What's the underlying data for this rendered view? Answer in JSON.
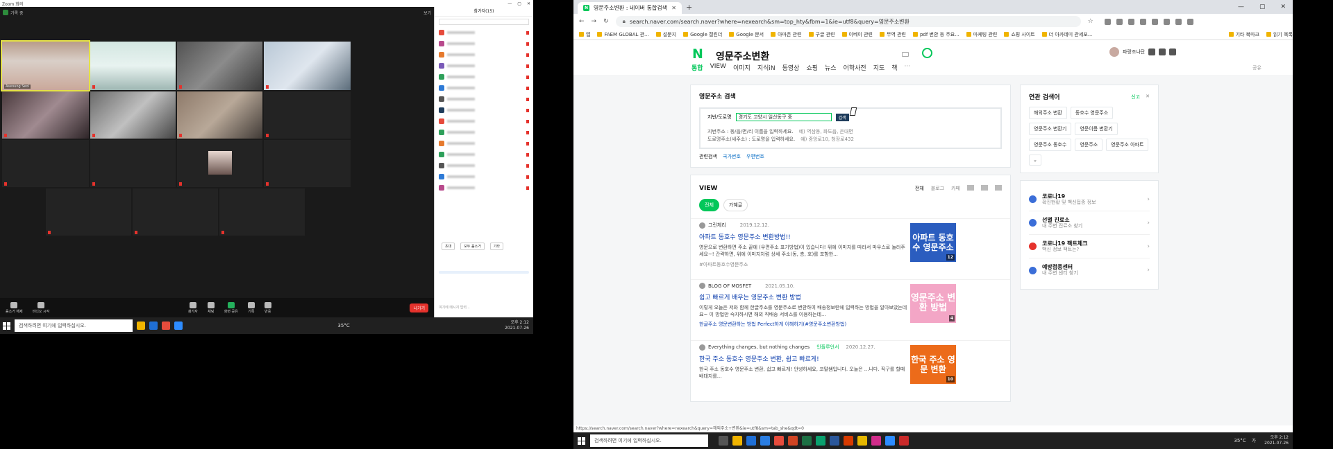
{
  "zoom": {
    "window_title": "Zoom 회의",
    "meeting_label": "기록 중",
    "view_label": "보기",
    "tiles": [
      {
        "name": "Aseoung Seol",
        "big": ""
      },
      {
        "name": "",
        "big": ""
      },
      {
        "name": "",
        "big": ""
      },
      {
        "name": "",
        "big": ""
      },
      {
        "name": "",
        "big": ""
      },
      {
        "name": "",
        "big": ""
      },
      {
        "name": "",
        "big": ""
      },
      {
        "name": "",
        "big": ""
      },
      {
        "name": "",
        "big": ""
      },
      {
        "name": "",
        "big": ""
      },
      {
        "name": "",
        "big": ""
      },
      {
        "name": "",
        "big": ""
      },
      {
        "name": "",
        "big": ""
      },
      {
        "name": "",
        "big": ""
      },
      {
        "name": "",
        "big": ""
      }
    ],
    "toolbar": {
      "audio": "음소거 해제",
      "video": "비디오 시작",
      "participants": "참가자",
      "chat": "채팅",
      "share": "화면 공유",
      "record": "기록",
      "reactions": "반응",
      "leave": "나가기"
    },
    "participants_panel": {
      "title": "참가자(15)",
      "search_placeholder": "",
      "buttons": [
        "초대",
        "모두 음소거",
        "기타"
      ],
      "chat_msg": "",
      "chat_input_placeholder": "여기에 메시지 입력..."
    }
  },
  "left_taskbar": {
    "search_placeholder": "검색하려면 여기에 입력하십시오.",
    "weather": "35°C",
    "time": "오후 2:12",
    "date": "2021-07-26"
  },
  "chrome": {
    "tab_title": "영문주소변환 : 네이버 통합검색",
    "new_tab": "+",
    "url": "search.naver.com/search.naver?where=nexearch&sm=top_hty&fbm=1&ie=utf8&query=영문주소변환",
    "bookmarks": [
      "앱",
      "FAEM GLOBAL 관...",
      "설문지",
      "Google 캘린더",
      "Google 문서",
      "아마존 관련",
      "구글 관련",
      "이베이 관련",
      "무역 관련",
      "pdf 변환 등 주요...",
      "마케팅 관련",
      "쇼핑 사이트",
      "더 아카데미 관세포...",
      "기타 북마크",
      "읽기 목록"
    ],
    "status_url": "https://search.naver.com/search.naver?where=nexearch&query=해외주소+변환&ie=utf8&sm=tab_she&qdt=0"
  },
  "naver": {
    "logo": "N",
    "query": "영문주소변환",
    "user_label": "파랑조나단",
    "tabs": [
      "통합",
      "VIEW",
      "이미지",
      "지식iN",
      "동영상",
      "쇼핑",
      "뉴스",
      "어학사전",
      "지도",
      "책",
      "···"
    ],
    "share": "공유",
    "addr_card": {
      "title": "영문주소 검색",
      "field_label": "지번/도로명",
      "field_value": "경기도 고양시 일산동구 중",
      "search_btn": "검색",
      "note1": "지번주소 : 동/읍/면/리 이름을 입력하세요.",
      "ex1": "예) 역삼동, 화도읍, 은대면",
      "note2": "도로명주소(새주소) : 도로명을 입력하세요.",
      "ex2": "예) 중앙로10, 청장로432",
      "rel_label": "관련검색",
      "rel_links": [
        "국가번호",
        "우편번호"
      ]
    },
    "view_card": {
      "title": "VIEW",
      "filters": [
        "전체",
        "블로그",
        "카페"
      ],
      "chips": [
        "전체",
        "가혜글"
      ],
      "posts": [
        {
          "author": "그린체리",
          "date": "2019.12.12.",
          "tag": "",
          "title": "아파트 동호수 영문주소 변환방법!!",
          "desc": "영문으로 변환하면 주소 끝에 (우편주소 표기방법)이 있습니다! 위에 이미지를 따라서 마우스로 놀러주세요~! 간략하면, 위에 이미지처럼 상세 주소(동, 층, 호)를 포함한...",
          "extra": "#아파트동호수영문주소",
          "thumb": "아파트 동호수 영문주소",
          "count": "12"
        },
        {
          "author": "BLOG OF MOSFET",
          "date": "2021.05.10.",
          "tag": "",
          "title": "쉽고 빠르게 배우는 영문주소 변환 방법",
          "desc": "이렇게 오늘은 저와 함께 한글주소를 영문주소로 변환하여 배송정보란에 입력하는 방법을 알아보았는데요~ 이 방법만 숙지하시면 해외 직배송 서비스를 이용하는데...",
          "extra": "한글주소 영문변환하는 방법 Perfect하게 이해하기(#영문주소변환방법)",
          "thumb": "영문주소 변환 방법",
          "count": "4"
        },
        {
          "author": "Everything changes, but nothing changes",
          "date": "2020.12.27.",
          "tag": "인플루언서",
          "title": "한국 주소 동호수 영문주소 변환, 쉽고 빠르게!",
          "desc": "한국 주소 동호수 영문주소 변환, 쉽고 빠르게! 안녕하세요, 코말쌤입니다. 오늘은 ...니다. 직구를 할때 배대지를...",
          "extra": "",
          "thumb": "한국 주소 영문 변환",
          "count": "10"
        }
      ]
    },
    "related": {
      "title": "연관 검색어",
      "report": "신고",
      "keywords": [
        "해외주소 변환",
        "동호수 영문주소",
        "영문주소 변환기",
        "영문이름 변환기",
        "영문주소 동호수",
        "영문주소",
        "영문주소 아파트"
      ]
    },
    "services": [
      {
        "title": "코로나19",
        "sub": "확진현황 및 백신접종 정보",
        "color": "#3b6ed8"
      },
      {
        "title": "선별 진료소",
        "sub": "내 주변 진료소 찾기",
        "color": "#3b6ed8"
      },
      {
        "title": "코로나19 팩트체크",
        "sub": "백신 정보 팩트는?",
        "color": "#e5322c"
      },
      {
        "title": "예방접종센터",
        "sub": "내 주변 센터 찾기",
        "color": "#3b6ed8"
      }
    ]
  },
  "right_taskbar": {
    "search_placeholder": "검색하려면 여기에 입력하십시오.",
    "weather": "35°C",
    "ime": "가",
    "time": "오후 2:12",
    "date": "2021-07-26"
  }
}
